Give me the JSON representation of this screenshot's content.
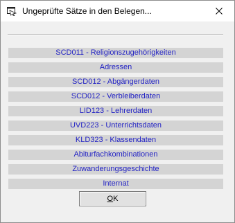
{
  "window": {
    "title": "Ungeprüfte Sätze in den Belegen..."
  },
  "items": [
    "SCD011 - Religionszugehörigkeiten",
    "Adressen",
    "SCD012 - Abgängerdaten",
    "SCD012 - Verbleiberdaten",
    "LID123 - Lehrerdaten",
    "UVD223 - Unterrichtsdaten",
    "KLD323 - Klassendaten",
    "Abiturfachkombinationen",
    "Zuwanderungsgeschichte",
    "Internat"
  ],
  "ok_button": {
    "accesskey": "O",
    "rest": "K"
  },
  "colors": {
    "link": "#2323c4",
    "row_background": "#d4d4d4",
    "dialog_background": "#f0f0f0"
  },
  "icons": {
    "title_icon": "dialog-app-icon",
    "close": "close-icon"
  }
}
